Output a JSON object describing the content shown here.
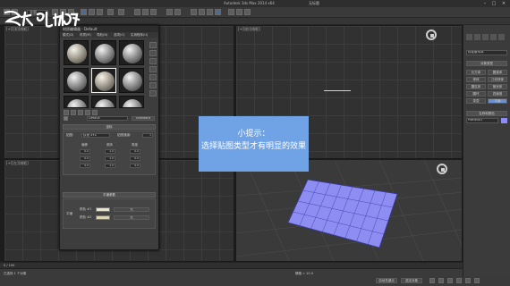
{
  "window": {
    "title": "Autodesk 3ds Max 2014 x64",
    "document": "无标题",
    "min_icon": "minimize-icon",
    "max_icon": "maximize-icon",
    "close_icon": "close-icon"
  },
  "watermark": {
    "text": "秒懂视频"
  },
  "toolbar": {
    "selection_filter": "全部"
  },
  "material_editor": {
    "title": "材质编辑器 - Default",
    "menu": [
      "模式(D)",
      "材质(M)",
      "导航(N)",
      "选项(O)",
      "实用程序(U)"
    ],
    "material_name": "Default",
    "material_type": "Standard",
    "shader_rollout": "坐标",
    "shader_label": "贴图:",
    "shader_value": "纹理 XYZ",
    "params_label": "贴图通道:",
    "params_value": "1",
    "spin_labels": [
      "偏移",
      "瓷砖",
      "角度"
    ],
    "spin_values": [
      "0.0",
      "1.0",
      "0.0",
      "0.0",
      "1.0",
      "0.0",
      "0.0",
      "1.0",
      "0.0"
    ],
    "noise_rollout": "平铺参数",
    "noise_rows": [
      {
        "label": "颜色 #1",
        "value": "无"
      },
      {
        "label": "颜色 #2",
        "value": "无"
      }
    ],
    "tiling_label": "平铺"
  },
  "tip": {
    "heading": "小提示：",
    "body": "选择贴图类型才有明显的效果"
  },
  "command_panel": {
    "selector": "标准基本体",
    "object_type_header": "对象类型",
    "buttons": [
      "长方体",
      "圆锥体",
      "球体",
      "几何球体",
      "圆柱体",
      "管状体",
      "圆环",
      "四棱锥",
      "茶壶",
      "平面"
    ],
    "name_header": "名称和颜色",
    "name_value": "Plane001"
  },
  "status": {
    "left_text": "已选择 1 个对象",
    "progress": "0 / 100",
    "grid_label": "栅格 = 10.0",
    "autokey": "自动关键点",
    "selected": "选定对象"
  },
  "viewport_labels": [
    "[+][顶][线框]",
    "[+][前][线框]",
    "[+][左][线框]",
    "[+][透视][真实]"
  ],
  "plane_color": "#8e8ef2"
}
